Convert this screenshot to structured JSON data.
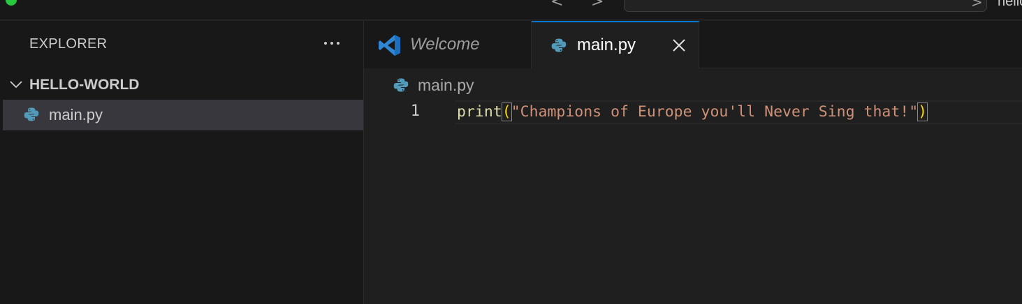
{
  "titlebar": {
    "nav_back": "<",
    "nav_forward": ">",
    "command_center_chevron": ">",
    "command_center_text": "hello"
  },
  "sidebar": {
    "title": "EXPLORER",
    "folder": {
      "name": "HELLO-WORLD",
      "expanded": true
    },
    "files": [
      {
        "name": "main.py",
        "icon": "python-icon",
        "selected": true
      }
    ]
  },
  "tabs": [
    {
      "label": "Welcome",
      "icon": "vscode-icon",
      "active": false,
      "italic": true
    },
    {
      "label": "main.py",
      "icon": "python-icon",
      "active": true
    }
  ],
  "editor": {
    "breadcrumb": "main.py",
    "lines": [
      {
        "number": "1",
        "tokens": [
          {
            "text": "print",
            "kind": "function"
          },
          {
            "text": "(",
            "kind": "paren"
          },
          {
            "text": "\"Champions of Europe you'll Never Sing that!\"",
            "kind": "string"
          },
          {
            "text": ")",
            "kind": "paren"
          }
        ]
      }
    ]
  },
  "colors": {
    "accent": "#0078d4",
    "function": "#dcdcaa",
    "string": "#ce9178",
    "bracket": "#ffd700",
    "python_blue": "#519aba"
  }
}
